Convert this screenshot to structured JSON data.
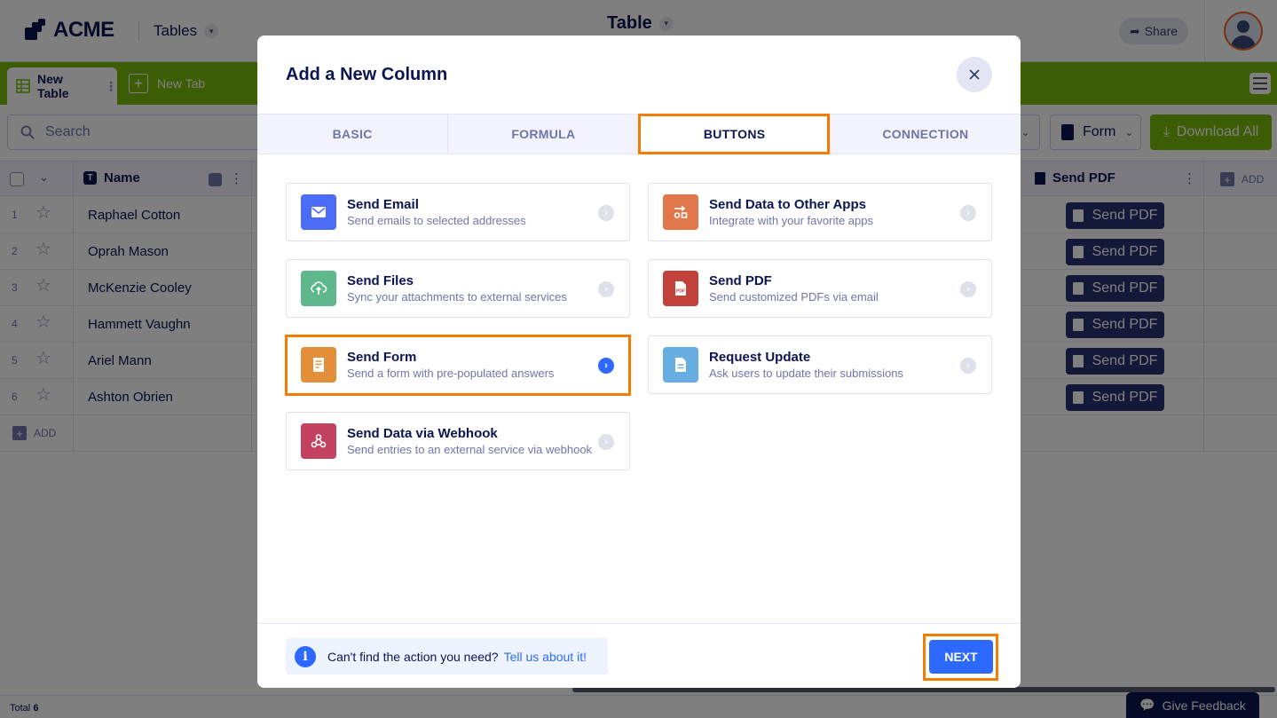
{
  "app": {
    "logo_text": "ACME",
    "tables_menu": "Tables",
    "title": "Table",
    "share_label": "Share"
  },
  "tabs": {
    "active_tab": "New Table",
    "new_tab": "New Tab"
  },
  "toolbar": {
    "search_placeholder": "Search",
    "form_dropdown": "Form",
    "download_all": "Download All"
  },
  "grid": {
    "columns": [
      "Name",
      "Send PDF"
    ],
    "add_column_label": "ADD",
    "rows": [
      {
        "num": "1",
        "name": "Raphael Cotton",
        "action": "Send PDF"
      },
      {
        "num": "2",
        "name": "Oprah Mason",
        "action": "Send PDF"
      },
      {
        "num": "3",
        "name": "McKenzie Cooley",
        "action": "Send PDF"
      },
      {
        "num": "4",
        "name": "Hammett Vaughn",
        "action": "Send PDF"
      },
      {
        "num": "5",
        "name": "Ariel Mann",
        "action": "Send PDF"
      },
      {
        "num": "6",
        "name": "Ashton Obrien",
        "action": "Send PDF"
      }
    ],
    "add_row_label": "ADD",
    "total_label": "Total",
    "total_count": "6"
  },
  "feedback_label": "Give Feedback",
  "modal": {
    "title": "Add a New Column",
    "tabs": [
      "BASIC",
      "FORMULA",
      "BUTTONS",
      "CONNECTION"
    ],
    "active_tab": "BUTTONS",
    "cards": [
      {
        "title": "Send Email",
        "desc": "Send emails to selected addresses",
        "icon": "email-icon",
        "color": "#4a6cf7"
      },
      {
        "title": "Send Data to Other Apps",
        "desc": "Integrate with your favorite apps",
        "icon": "integration-icon",
        "color": "#e0764a"
      },
      {
        "title": "Send Files",
        "desc": "Sync your attachments to external services",
        "icon": "cloud-upload-icon",
        "color": "#5fb88b"
      },
      {
        "title": "Send PDF",
        "desc": "Send customized PDFs via email",
        "icon": "pdf-icon",
        "color": "#c0423a"
      },
      {
        "title": "Send Form",
        "desc": "Send a form with pre-populated answers",
        "icon": "form-icon",
        "color": "#e38f3a"
      },
      {
        "title": "Request Update",
        "desc": "Ask users to update their submissions",
        "icon": "document-icon",
        "color": "#66aee2"
      },
      {
        "title": "Send Data via Webhook",
        "desc": "Send entries to an external service via webhook",
        "icon": "webhook-icon",
        "color": "#c24260"
      }
    ],
    "selected_card": "Send Form",
    "footer": {
      "info_text": "Can't find the action you need?",
      "info_link": "Tell us about it!",
      "next_label": "NEXT"
    }
  },
  "colors": {
    "accent": "#2e69ff",
    "highlight": "#f57c00",
    "tabbar": "#78bb07",
    "navy": "#0a1551"
  }
}
